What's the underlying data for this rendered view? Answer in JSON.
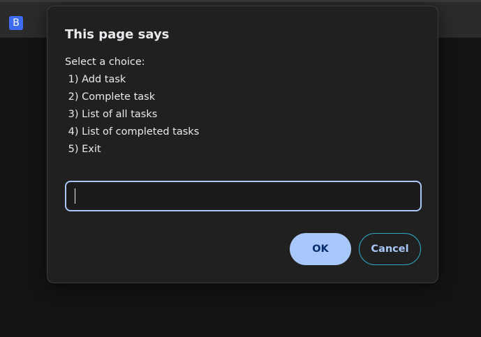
{
  "browser": {
    "tab_favicon_letter": "B",
    "favicon_color": "#3d6cf2"
  },
  "dialog": {
    "title": "This page says",
    "message_lines": [
      "Select a choice:",
      " 1) Add task",
      " 2) Complete task",
      " 3) List of all tasks",
      " 4) List of completed tasks",
      " 5) Exit"
    ],
    "input_value": "",
    "ok_label": "OK",
    "cancel_label": "Cancel"
  },
  "colors": {
    "dialog_background": "#202020",
    "accent": "#a8c7fa",
    "accent_text": "#062e6f",
    "cancel_border": "#2ea8c9"
  }
}
